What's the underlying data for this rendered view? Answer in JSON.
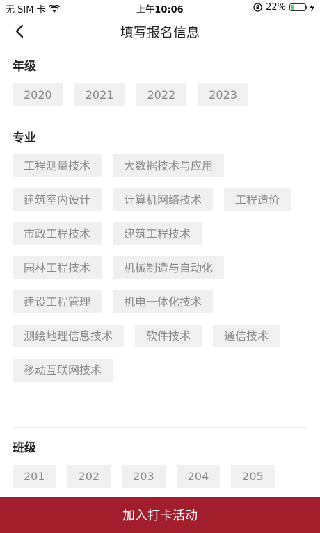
{
  "status_bar": {
    "carrier": "无 SIM 卡",
    "time": "上午10:06",
    "battery_percent": "22%",
    "battery_level": 0.22
  },
  "nav": {
    "title": "填写报名信息"
  },
  "grade": {
    "title": "年级",
    "options": [
      "2020",
      "2021",
      "2022",
      "2023"
    ]
  },
  "major": {
    "title": "专业",
    "options": [
      "工程测量技术",
      "大数据技术与应用",
      "建筑室内设计",
      "计算机网络技术",
      "工程造价",
      "市政工程技术",
      "建筑工程技术",
      "园林工程技术",
      "机械制造与自动化",
      "建设工程管理",
      "机电一体化技术",
      "测绘地理信息技术",
      "软件技术",
      "通信技术",
      "移动互联网技术"
    ]
  },
  "class": {
    "title": "班级",
    "options": [
      "201",
      "202",
      "203",
      "204",
      "205"
    ]
  },
  "submit": {
    "label": "加入打卡活动"
  },
  "colors": {
    "accent": "#a31e2d",
    "chip_bg": "#f0f0f0",
    "chip_text": "#888888"
  }
}
